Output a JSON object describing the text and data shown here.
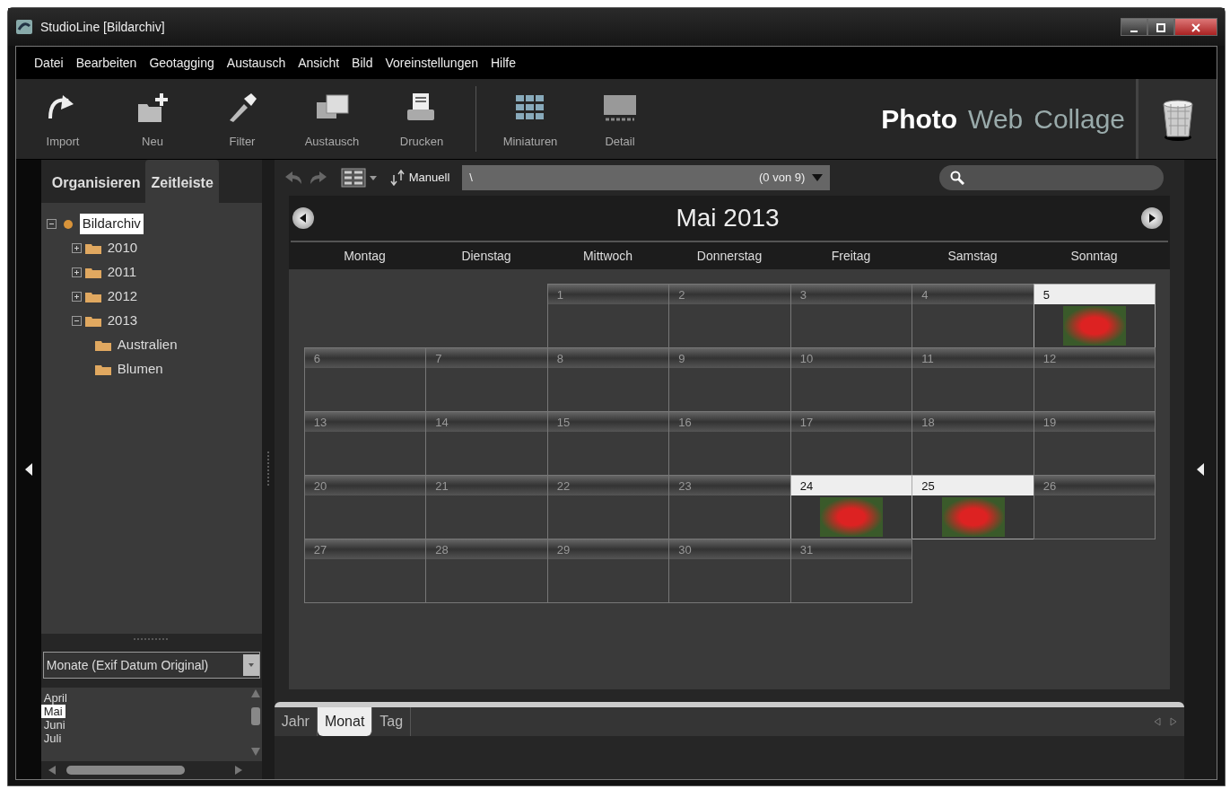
{
  "window": {
    "title": "StudioLine [Bildarchiv]"
  },
  "menu": [
    "Datei",
    "Bearbeiten",
    "Geotagging",
    "Austausch",
    "Ansicht",
    "Bild",
    "Voreinstellungen",
    "Hilfe"
  ],
  "toolbar": [
    {
      "kind": "import",
      "label": "Import"
    },
    {
      "kind": "new",
      "label": "Neu"
    },
    {
      "kind": "filter",
      "label": "Filter"
    },
    {
      "kind": "exchange",
      "label": "Austausch"
    },
    {
      "kind": "print",
      "label": "Drucken"
    },
    {
      "kind": "thumbnails",
      "label": "Miniaturen"
    },
    {
      "kind": "detail",
      "label": "Detail"
    }
  ],
  "modes": [
    {
      "label": "Photo",
      "selected": true
    },
    {
      "label": "Web",
      "selected": false
    },
    {
      "label": "Collage",
      "selected": false
    }
  ],
  "left_tabs": [
    {
      "label": "Organisieren",
      "selected": false
    },
    {
      "label": "Zeitleiste",
      "selected": true
    }
  ],
  "tree": [
    {
      "label": "Bildarchiv",
      "expanded": true,
      "selected": true,
      "children": [
        {
          "label": "2010",
          "expanded": false,
          "selected": false
        },
        {
          "label": "2011",
          "expanded": false,
          "selected": false
        },
        {
          "label": "2012",
          "expanded": false,
          "selected": false
        },
        {
          "label": "2013",
          "expanded": true,
          "selected": false,
          "children": [
            {
              "label": "Australien",
              "selected": false
            },
            {
              "label": "Blumen",
              "selected": false
            }
          ]
        }
      ]
    }
  ],
  "grouping_select": {
    "value": "Monate (Exif Datum Original)"
  },
  "month_list": [
    {
      "label": "April",
      "selected": false
    },
    {
      "label": "Mai",
      "selected": true
    },
    {
      "label": "Juni",
      "selected": false
    },
    {
      "label": "Juli",
      "selected": false
    }
  ],
  "view_bar": {
    "sort": "Manuell",
    "path": "\\",
    "count": "(0 von 9)"
  },
  "calendar": {
    "title": "Mai 2013",
    "weekdays": [
      "Montag",
      "Dienstag",
      "Mittwoch",
      "Donnerstag",
      "Freitag",
      "Samstag",
      "Sonntag"
    ],
    "cells": [
      {
        "kind": "blank"
      },
      {
        "kind": "blank"
      },
      {
        "kind": "day",
        "label": "1",
        "has_photo": false
      },
      {
        "kind": "day",
        "label": "2",
        "has_photo": false
      },
      {
        "kind": "day",
        "label": "3",
        "has_photo": false
      },
      {
        "kind": "day",
        "label": "4",
        "has_photo": false
      },
      {
        "kind": "day",
        "label": "5",
        "has_photo": true
      },
      {
        "kind": "day",
        "label": "6",
        "has_photo": false
      },
      {
        "kind": "day",
        "label": "7",
        "has_photo": false
      },
      {
        "kind": "day",
        "label": "8",
        "has_photo": false
      },
      {
        "kind": "day",
        "label": "9",
        "has_photo": false
      },
      {
        "kind": "day",
        "label": "10",
        "has_photo": false
      },
      {
        "kind": "day",
        "label": "11",
        "has_photo": false
      },
      {
        "kind": "day",
        "label": "12",
        "has_photo": false
      },
      {
        "kind": "day",
        "label": "13",
        "has_photo": false
      },
      {
        "kind": "day",
        "label": "14",
        "has_photo": false
      },
      {
        "kind": "day",
        "label": "15",
        "has_photo": false
      },
      {
        "kind": "day",
        "label": "16",
        "has_photo": false
      },
      {
        "kind": "day",
        "label": "17",
        "has_photo": false
      },
      {
        "kind": "day",
        "label": "18",
        "has_photo": false
      },
      {
        "kind": "day",
        "label": "19",
        "has_photo": false
      },
      {
        "kind": "day",
        "label": "20",
        "has_photo": false
      },
      {
        "kind": "day",
        "label": "21",
        "has_photo": false
      },
      {
        "kind": "day",
        "label": "22",
        "has_photo": false
      },
      {
        "kind": "day",
        "label": "23",
        "has_photo": false
      },
      {
        "kind": "day",
        "label": "24",
        "has_photo": true
      },
      {
        "kind": "day",
        "label": "25",
        "has_photo": true
      },
      {
        "kind": "day",
        "label": "26",
        "has_photo": false
      },
      {
        "kind": "day",
        "label": "27",
        "has_photo": false
      },
      {
        "kind": "day",
        "label": "28",
        "has_photo": false
      },
      {
        "kind": "day",
        "label": "29",
        "has_photo": false
      },
      {
        "kind": "day",
        "label": "30",
        "has_photo": false
      },
      {
        "kind": "day",
        "label": "31",
        "has_photo": false
      }
    ]
  },
  "bottom_tabs": [
    {
      "label": "Jahr",
      "selected": false
    },
    {
      "label": "Monat",
      "selected": true
    },
    {
      "label": "Tag",
      "selected": false
    }
  ]
}
